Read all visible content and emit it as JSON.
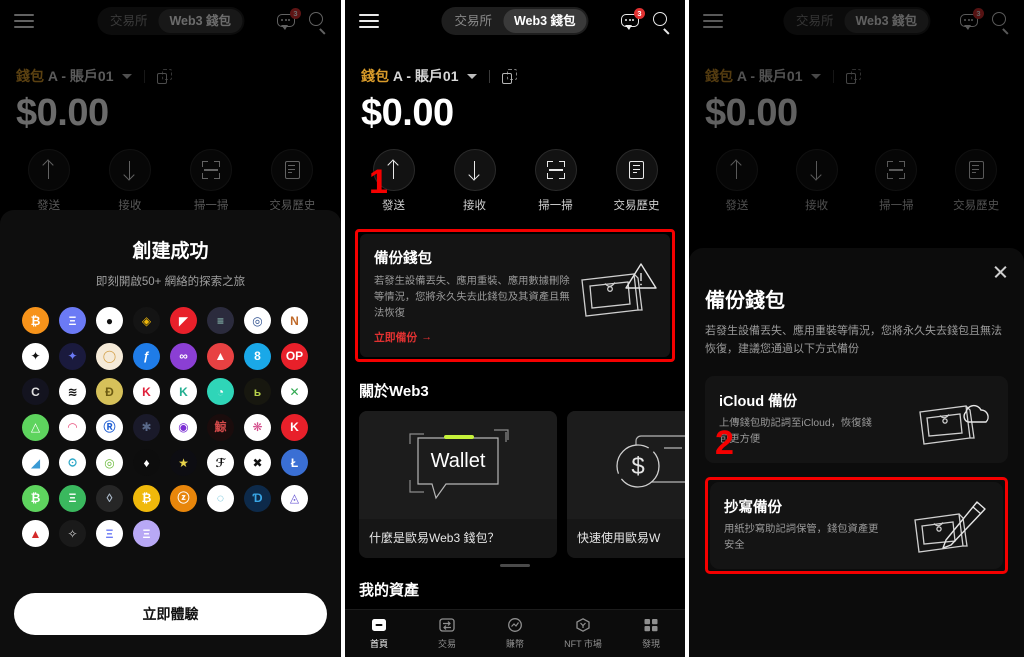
{
  "header": {
    "menu_icon": "hamburger-menu-icon",
    "segments": [
      {
        "label": "交易所",
        "active": false
      },
      {
        "label": "Web3 錢包",
        "active": true
      }
    ],
    "chat_icon": "chat-bubble-icon",
    "chat_badge": "3",
    "search_icon": "search-icon"
  },
  "wallet": {
    "name_brand": "錢包",
    "name_rest": " A - 賬戶01",
    "dropdown_icon": "chevron-down-icon",
    "copy_icon": "copy-icon",
    "balance": "$0.00"
  },
  "actions": [
    {
      "label": "發送",
      "icon": "arrow-up-icon"
    },
    {
      "label": "接收",
      "icon": "arrow-down-icon"
    },
    {
      "label": "掃一掃",
      "icon": "scan-icon"
    },
    {
      "label": "交易歷史",
      "icon": "history-list-icon"
    }
  ],
  "backup_card": {
    "title": "備份錢包",
    "description": "若發生設備丟失、應用重裝、應用數據刪除等情況，您將永久失去此錢包及其資產且無法恢復",
    "cta": "立即備份",
    "cta_arrow": "→",
    "icon": "wallet-warning-icon"
  },
  "about": {
    "section_title": "關於Web3",
    "cards": [
      {
        "caption": "什麼是歐易Web3 錢包？",
        "art": "wallet-speech-bubble-icon"
      },
      {
        "caption": "快速使用歐易W",
        "art": "dollar-coin-card-icon"
      }
    ]
  },
  "assets_section_title": "我的資產",
  "bottom_nav": [
    {
      "label": "首頁",
      "icon": "home-icon",
      "active": true
    },
    {
      "label": "交易",
      "icon": "trade-swap-icon",
      "active": false
    },
    {
      "label": "賺幣",
      "icon": "earn-chart-icon",
      "active": false
    },
    {
      "label": "NFT 市場",
      "icon": "nft-hexagon-icon",
      "active": false
    },
    {
      "label": "發現",
      "icon": "discover-grid-icon",
      "active": false
    }
  ],
  "create_success": {
    "title": "創建成功",
    "subtitle": "即刻開啟50+ 網絡的探索之旅",
    "cta": "立即體驗",
    "tokens": [
      {
        "name": "bitcoin",
        "glyph": "₿",
        "bg": "#f7931a",
        "fg": "#ffffff"
      },
      {
        "name": "ethereum",
        "glyph": "Ξ",
        "bg": "#6b7af5",
        "fg": "#ffffff"
      },
      {
        "name": "polkadot",
        "glyph": "●",
        "bg": "#ffffff",
        "fg": "#111111"
      },
      {
        "name": "bnb-chain",
        "glyph": "◈",
        "bg": "#141414",
        "fg": "#f0b90b"
      },
      {
        "name": "tron",
        "glyph": "◤",
        "bg": "#e8202a",
        "fg": "#ffffff"
      },
      {
        "name": "solana",
        "glyph": "≡",
        "bg": "#2b2b3d",
        "fg": "#9dd8c8"
      },
      {
        "name": "arbitrum",
        "glyph": "◎",
        "bg": "#ffffff",
        "fg": "#2d4f8f"
      },
      {
        "name": "near",
        "glyph": "N",
        "bg": "#ffffff",
        "fg": "#c06a2a"
      },
      {
        "name": "chain-dark",
        "glyph": "✦",
        "bg": "#ffffff",
        "fg": "#111111"
      },
      {
        "name": "chain-navy",
        "glyph": "✦",
        "bg": "#1a1a3d",
        "fg": "#6b7af5"
      },
      {
        "name": "circle-token",
        "glyph": "◯",
        "bg": "#f5ead8",
        "fg": "#d4a14a"
      },
      {
        "name": "filecoin",
        "glyph": "ƒ",
        "bg": "#1f7ce8",
        "fg": "#ffffff"
      },
      {
        "name": "infinity-token",
        "glyph": "∞",
        "bg": "#8b3fd4",
        "fg": "#ffffff"
      },
      {
        "name": "avalanche",
        "glyph": "▲",
        "bg": "#e84142",
        "fg": "#ffffff"
      },
      {
        "name": "blue-token",
        "glyph": "8",
        "bg": "#1aa8e8",
        "fg": "#ffffff"
      },
      {
        "name": "optimism",
        "glyph": "OP",
        "bg": "#e8202a",
        "fg": "#ffffff"
      },
      {
        "name": "core-token",
        "glyph": "C",
        "bg": "#13131f",
        "fg": "#e0e0e0"
      },
      {
        "name": "aptos",
        "glyph": "≋",
        "bg": "#ffffff",
        "fg": "#111111"
      },
      {
        "name": "doge",
        "glyph": "Ð",
        "bg": "#d6c15a",
        "fg": "#6b5a12"
      },
      {
        "name": "kadena",
        "glyph": "K",
        "bg": "#ffffff",
        "fg": "#e0213b"
      },
      {
        "name": "kucoin-token",
        "glyph": "K",
        "bg": "#ffffff",
        "fg": "#23af91"
      },
      {
        "name": "teal-token",
        "glyph": "◔",
        "bg": "#2fd5b8",
        "fg": "#ffffff"
      },
      {
        "name": "bitgreen",
        "glyph": "ь",
        "bg": "#17170f",
        "fg": "#b8d24a"
      },
      {
        "name": "x-token",
        "glyph": "✕",
        "bg": "#ffffff",
        "fg": "#2fa84f"
      },
      {
        "name": "green-triangle",
        "glyph": "△",
        "bg": "#5ed45e",
        "fg": "#ffffff"
      },
      {
        "name": "sunset-token",
        "glyph": "◠",
        "bg": "#ffffff",
        "fg": "#e8507d"
      },
      {
        "name": "r-token",
        "glyph": "Ⓡ",
        "bg": "#ffffff",
        "fg": "#1f5fd4"
      },
      {
        "name": "dark-node",
        "glyph": "✱",
        "bg": "#1a1a2a",
        "fg": "#5a6a8a"
      },
      {
        "name": "purple-orb",
        "glyph": "◉",
        "bg": "#ffffff",
        "fg": "#7b2fd4"
      },
      {
        "name": "whale-token",
        "glyph": "鯨",
        "bg": "#1a0c0c",
        "fg": "#d44a4a"
      },
      {
        "name": "brain-token",
        "glyph": "❋",
        "bg": "#ffffff",
        "fg": "#d44a8a"
      },
      {
        "name": "k-red-token",
        "glyph": "K",
        "bg": "#e8202a",
        "fg": "#ffffff"
      },
      {
        "name": "landscape-token",
        "glyph": "◢",
        "bg": "#ffffff",
        "fg": "#3a9ad4"
      },
      {
        "name": "hh-token",
        "glyph": "ꖴ",
        "bg": "#ffffff",
        "fg": "#2fa8c8"
      },
      {
        "name": "ring-token",
        "glyph": "◎",
        "bg": "#ffffff",
        "fg": "#6aba3a"
      },
      {
        "name": "ton",
        "glyph": "♦",
        "bg": "#0d0d0d",
        "fg": "#ffffff"
      },
      {
        "name": "star-token",
        "glyph": "★",
        "bg": "#0d0d12",
        "fg": "#e8d44a"
      },
      {
        "name": "f-token",
        "glyph": "ℱ",
        "bg": "#ffffff",
        "fg": "#111111"
      },
      {
        "name": "x-cross-token",
        "glyph": "✖",
        "bg": "#ffffff",
        "fg": "#111111"
      },
      {
        "name": "litecoin",
        "glyph": "Ł",
        "bg": "#3a6fd4",
        "fg": "#ffffff"
      },
      {
        "name": "bitcoin-cash",
        "glyph": "₿",
        "bg": "#5ed45e",
        "fg": "#ffffff"
      },
      {
        "name": "eth-classic",
        "glyph": "Ξ",
        "bg": "#3ab85e",
        "fg": "#ffffff"
      },
      {
        "name": "flow-token",
        "glyph": "◊",
        "bg": "#262626",
        "fg": "#aab8c8"
      },
      {
        "name": "bitcoin-gold",
        "glyph": "₿",
        "bg": "#f0b90b",
        "fg": "#ffffff"
      },
      {
        "name": "zcash",
        "glyph": "ⓩ",
        "bg": "#e8860b",
        "fg": "#ffffff"
      },
      {
        "name": "ripple-token",
        "glyph": "◌",
        "bg": "#ffffff",
        "fg": "#2fa8c8"
      },
      {
        "name": "dash",
        "glyph": "Ɗ",
        "bg": "#0d2a4a",
        "fg": "#3aa8e8"
      },
      {
        "name": "arweave",
        "glyph": "◬",
        "bg": "#ffffff",
        "fg": "#6b5ad4"
      },
      {
        "name": "ark-token",
        "glyph": "▲",
        "bg": "#ffffff",
        "fg": "#d42a2a"
      },
      {
        "name": "stellar",
        "glyph": "✧",
        "bg": "#1a1a1a",
        "fg": "#cfcfcf"
      },
      {
        "name": "eth-white",
        "glyph": "Ξ",
        "bg": "#ffffff",
        "fg": "#6b7af5"
      },
      {
        "name": "eth-purple",
        "glyph": "Ξ",
        "bg": "#b8a8f5",
        "fg": "#ffffff"
      }
    ]
  },
  "backup_sheet": {
    "close_icon": "close-icon",
    "title": "備份錢包",
    "description": "若發生設備丟失、應用重裝等情況，您將永久失去錢包且無法恢復，建議您通過以下方式備份",
    "options": [
      {
        "title": "iCloud 備份",
        "description": "上傳錢包助記詞至iCloud，恢復錢包更方便",
        "icon": "wallet-cloud-icon",
        "highlighted": false
      },
      {
        "title": "抄寫備份",
        "description": "用紙抄寫助記詞保管，錢包資產更安全",
        "icon": "wallet-pen-icon",
        "highlighted": true
      }
    ]
  },
  "annotations": [
    {
      "label": "1",
      "panel": "panel-2"
    },
    {
      "label": "2",
      "panel": "panel-3"
    }
  ],
  "colors": {
    "accent_red": "#f50000",
    "brand_gold": "#d99b2a",
    "background": "#000000",
    "card": "#141414"
  }
}
